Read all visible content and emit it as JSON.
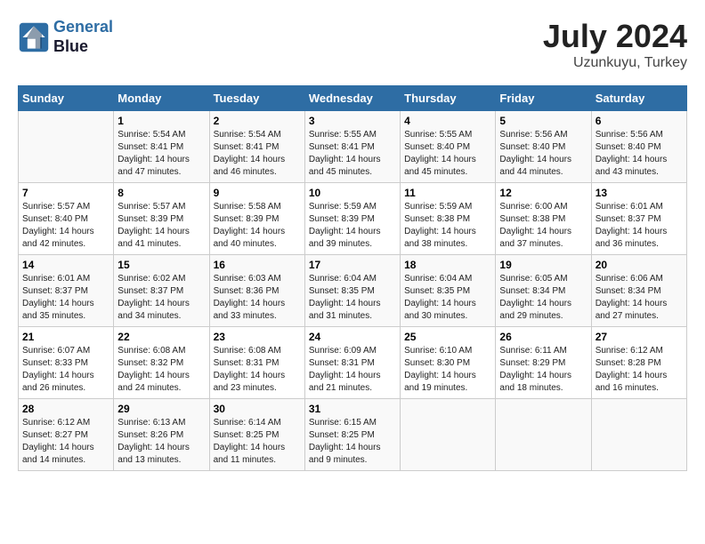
{
  "header": {
    "logo_line1": "General",
    "logo_line2": "Blue",
    "month_year": "July 2024",
    "location": "Uzunkuyu, Turkey"
  },
  "columns": [
    "Sunday",
    "Monday",
    "Tuesday",
    "Wednesday",
    "Thursday",
    "Friday",
    "Saturday"
  ],
  "weeks": [
    [
      {
        "day": "",
        "info": ""
      },
      {
        "day": "1",
        "info": "Sunrise: 5:54 AM\nSunset: 8:41 PM\nDaylight: 14 hours\nand 47 minutes."
      },
      {
        "day": "2",
        "info": "Sunrise: 5:54 AM\nSunset: 8:41 PM\nDaylight: 14 hours\nand 46 minutes."
      },
      {
        "day": "3",
        "info": "Sunrise: 5:55 AM\nSunset: 8:41 PM\nDaylight: 14 hours\nand 45 minutes."
      },
      {
        "day": "4",
        "info": "Sunrise: 5:55 AM\nSunset: 8:40 PM\nDaylight: 14 hours\nand 45 minutes."
      },
      {
        "day": "5",
        "info": "Sunrise: 5:56 AM\nSunset: 8:40 PM\nDaylight: 14 hours\nand 44 minutes."
      },
      {
        "day": "6",
        "info": "Sunrise: 5:56 AM\nSunset: 8:40 PM\nDaylight: 14 hours\nand 43 minutes."
      }
    ],
    [
      {
        "day": "7",
        "info": "Sunrise: 5:57 AM\nSunset: 8:40 PM\nDaylight: 14 hours\nand 42 minutes."
      },
      {
        "day": "8",
        "info": "Sunrise: 5:57 AM\nSunset: 8:39 PM\nDaylight: 14 hours\nand 41 minutes."
      },
      {
        "day": "9",
        "info": "Sunrise: 5:58 AM\nSunset: 8:39 PM\nDaylight: 14 hours\nand 40 minutes."
      },
      {
        "day": "10",
        "info": "Sunrise: 5:59 AM\nSunset: 8:39 PM\nDaylight: 14 hours\nand 39 minutes."
      },
      {
        "day": "11",
        "info": "Sunrise: 5:59 AM\nSunset: 8:38 PM\nDaylight: 14 hours\nand 38 minutes."
      },
      {
        "day": "12",
        "info": "Sunrise: 6:00 AM\nSunset: 8:38 PM\nDaylight: 14 hours\nand 37 minutes."
      },
      {
        "day": "13",
        "info": "Sunrise: 6:01 AM\nSunset: 8:37 PM\nDaylight: 14 hours\nand 36 minutes."
      }
    ],
    [
      {
        "day": "14",
        "info": "Sunrise: 6:01 AM\nSunset: 8:37 PM\nDaylight: 14 hours\nand 35 minutes."
      },
      {
        "day": "15",
        "info": "Sunrise: 6:02 AM\nSunset: 8:37 PM\nDaylight: 14 hours\nand 34 minutes."
      },
      {
        "day": "16",
        "info": "Sunrise: 6:03 AM\nSunset: 8:36 PM\nDaylight: 14 hours\nand 33 minutes."
      },
      {
        "day": "17",
        "info": "Sunrise: 6:04 AM\nSunset: 8:35 PM\nDaylight: 14 hours\nand 31 minutes."
      },
      {
        "day": "18",
        "info": "Sunrise: 6:04 AM\nSunset: 8:35 PM\nDaylight: 14 hours\nand 30 minutes."
      },
      {
        "day": "19",
        "info": "Sunrise: 6:05 AM\nSunset: 8:34 PM\nDaylight: 14 hours\nand 29 minutes."
      },
      {
        "day": "20",
        "info": "Sunrise: 6:06 AM\nSunset: 8:34 PM\nDaylight: 14 hours\nand 27 minutes."
      }
    ],
    [
      {
        "day": "21",
        "info": "Sunrise: 6:07 AM\nSunset: 8:33 PM\nDaylight: 14 hours\nand 26 minutes."
      },
      {
        "day": "22",
        "info": "Sunrise: 6:08 AM\nSunset: 8:32 PM\nDaylight: 14 hours\nand 24 minutes."
      },
      {
        "day": "23",
        "info": "Sunrise: 6:08 AM\nSunset: 8:31 PM\nDaylight: 14 hours\nand 23 minutes."
      },
      {
        "day": "24",
        "info": "Sunrise: 6:09 AM\nSunset: 8:31 PM\nDaylight: 14 hours\nand 21 minutes."
      },
      {
        "day": "25",
        "info": "Sunrise: 6:10 AM\nSunset: 8:30 PM\nDaylight: 14 hours\nand 19 minutes."
      },
      {
        "day": "26",
        "info": "Sunrise: 6:11 AM\nSunset: 8:29 PM\nDaylight: 14 hours\nand 18 minutes."
      },
      {
        "day": "27",
        "info": "Sunrise: 6:12 AM\nSunset: 8:28 PM\nDaylight: 14 hours\nand 16 minutes."
      }
    ],
    [
      {
        "day": "28",
        "info": "Sunrise: 6:12 AM\nSunset: 8:27 PM\nDaylight: 14 hours\nand 14 minutes."
      },
      {
        "day": "29",
        "info": "Sunrise: 6:13 AM\nSunset: 8:26 PM\nDaylight: 14 hours\nand 13 minutes."
      },
      {
        "day": "30",
        "info": "Sunrise: 6:14 AM\nSunset: 8:25 PM\nDaylight: 14 hours\nand 11 minutes."
      },
      {
        "day": "31",
        "info": "Sunrise: 6:15 AM\nSunset: 8:25 PM\nDaylight: 14 hours\nand 9 minutes."
      },
      {
        "day": "",
        "info": ""
      },
      {
        "day": "",
        "info": ""
      },
      {
        "day": "",
        "info": ""
      }
    ]
  ]
}
